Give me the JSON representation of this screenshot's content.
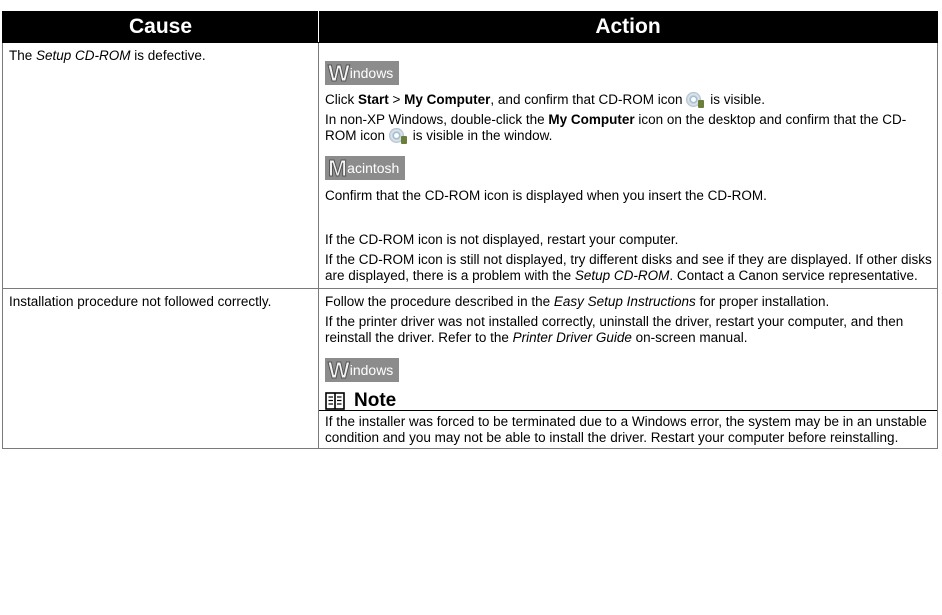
{
  "table": {
    "header": {
      "cause": "Cause",
      "action": "Action"
    },
    "rows": [
      {
        "cause": {
          "pre": "The ",
          "em": "Setup CD-ROM",
          "post": " is defective."
        },
        "windows_badge": {
          "initial": "W",
          "rest": "indows"
        },
        "win_p1": {
          "a": "Click ",
          "b1": "Start",
          "c": " > ",
          "b2": "My Computer",
          "d": ", and confirm that CD-ROM icon",
          "e": " is visible."
        },
        "win_p2": {
          "a": "In non-XP Windows, double-click the ",
          "b": "My Computer",
          "c": " icon on the desktop and confirm that the CD-ROM icon",
          "d": " is visible in the window."
        },
        "mac_badge": {
          "initial": "M",
          "rest": "acintosh"
        },
        "mac_p1": "Confirm that the CD-ROM icon is displayed when you insert the CD-ROM.",
        "p_restart": "If the CD-ROM icon is not displayed, restart your computer.",
        "p_still": {
          "a": "If the CD-ROM icon is still not displayed, try different disks and see if they are displayed. If other disks are displayed, there is a problem with the ",
          "em": "Setup CD-ROM",
          "b": ". Contact a Canon service representative."
        }
      },
      {
        "cause": "Installation procedure not followed correctly.",
        "p1": {
          "a": "Follow the procedure described in the ",
          "em": "Easy Setup Instructions",
          "b": " for proper installation."
        },
        "p2": {
          "a": "If the printer driver was not installed correctly, uninstall the driver, restart your computer, and then reinstall the driver. Refer to the ",
          "em": "Printer Driver Guide",
          "b": " on-screen manual."
        },
        "windows_badge": {
          "initial": "W",
          "rest": "indows"
        },
        "note_label": "Note",
        "note_text": "If the installer was forced to be terminated due to a Windows error, the system may be in an unstable condition and you may not be able to install the driver. Restart your computer before reinstalling."
      }
    ]
  }
}
